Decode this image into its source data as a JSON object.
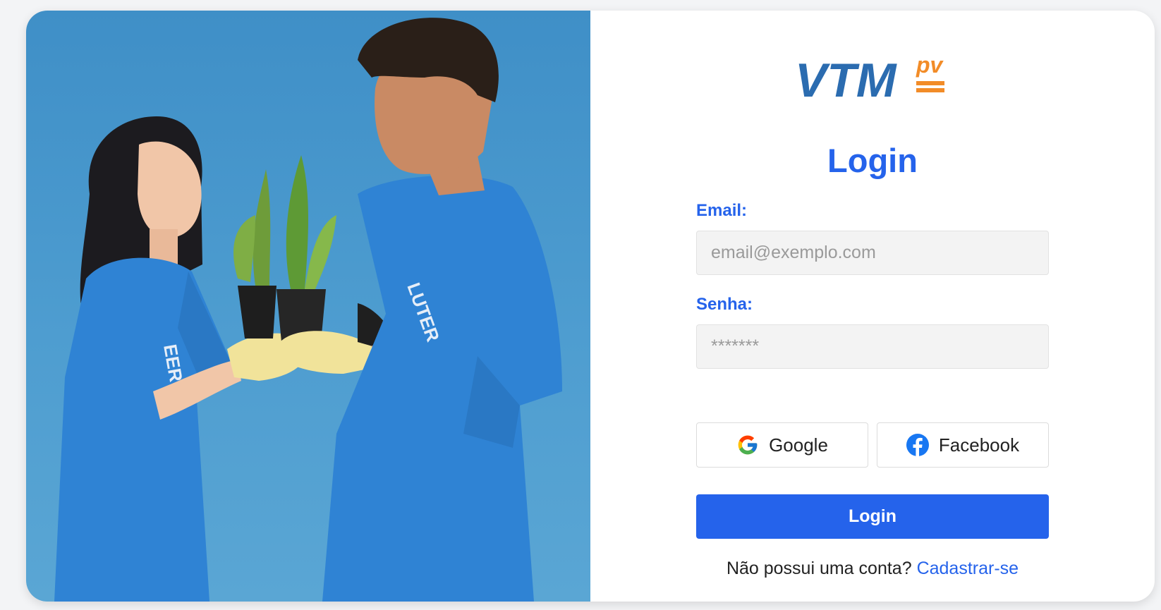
{
  "colors": {
    "brand": "#2563eb",
    "logo_blue": "#2b6cb0",
    "logo_orange": "#f28c28"
  },
  "hero_image": {
    "icon": "volunteers-holding-plants-photo"
  },
  "logo": {
    "text": "VTM",
    "suffix": "pv"
  },
  "form": {
    "title": "Login",
    "email_label": "Email:",
    "email_placeholder": "email@exemplo.com",
    "password_label": "Senha:",
    "password_placeholder": "*******",
    "google_label": "Google",
    "google_icon": "google-icon",
    "facebook_label": "Facebook",
    "facebook_icon": "facebook-icon",
    "login_button": "Login",
    "signup_prompt": "Não possui uma conta?",
    "signup_link": "Cadastrar-se"
  }
}
